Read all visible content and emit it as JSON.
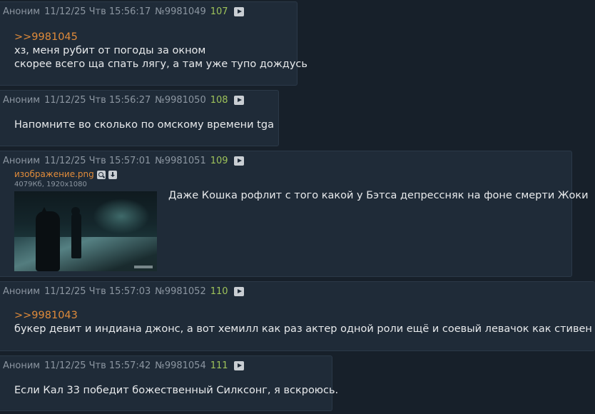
{
  "posts": [
    {
      "author": "Аноним",
      "date": "11/12/25 Чтв 15:56:17",
      "id": "№9981049",
      "num": "107",
      "reply": ">>9981045",
      "lines": [
        "хз, меня рубит от погоды за окном",
        "скорее всего ща спать лягу, а там уже тупо дождусь"
      ]
    },
    {
      "author": "Аноним",
      "date": "11/12/25 Чтв 15:56:27",
      "id": "№9981050",
      "num": "108",
      "lines": [
        "Напомните во сколько по омскому времени tga"
      ]
    },
    {
      "author": "Аноним",
      "date": "11/12/25 Чтв 15:57:01",
      "id": "№9981051",
      "num": "109",
      "file": {
        "name": "изображение.png",
        "meta": "4079Кб, 1920x1080",
        "search_icon": "search-icon",
        "download_icon": "download-icon"
      },
      "lines": [
        "Даже Кошка рофлит с того какой у Бэтса депрессняк на фоне смерти Жоки"
      ]
    },
    {
      "author": "Аноним",
      "date": "11/12/25 Чтв 15:57:03",
      "id": "№9981052",
      "num": "110",
      "reply": ">>9981043",
      "lines": [
        "букер девит и индиана джонс, а вот хемилл как раз актер одной роли ещё и соевый левачок как стивен кинг"
      ]
    },
    {
      "author": "Аноним",
      "date": "11/12/25 Чтв 15:57:42",
      "id": "№9981054",
      "num": "111",
      "lines": [
        "Если Кал 33 победит божественный Силксонг, я вскроюсь."
      ]
    }
  ],
  "colors": {
    "background": "#17202a",
    "post_bg": "#1f2b38",
    "reply_link": "#e08b3a",
    "post_number": "#9ec35a",
    "meta_text": "#8c96a1"
  },
  "icons": {
    "play": "play-icon"
  }
}
